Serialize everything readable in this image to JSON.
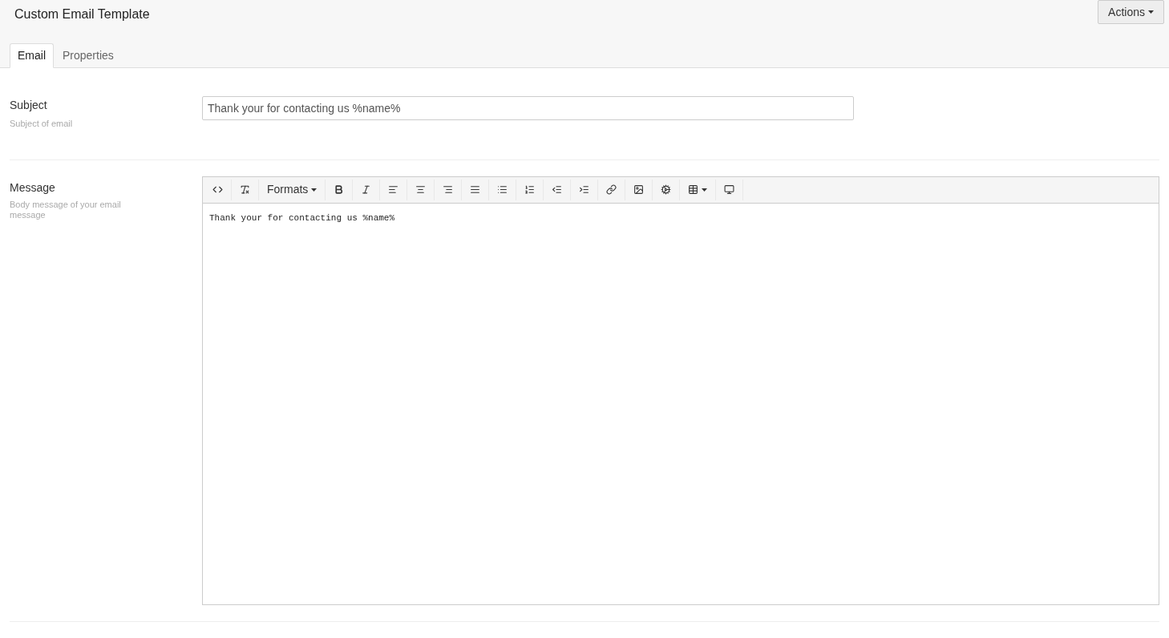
{
  "header": {
    "title": "Custom Email Template",
    "actions_button": "Actions"
  },
  "tabs": [
    {
      "label": "Email",
      "selected": true
    },
    {
      "label": "Properties",
      "selected": false
    }
  ],
  "subject": {
    "label": "Subject",
    "hint": "Subject of email",
    "value": "Thank your for contacting us %name%"
  },
  "message": {
    "label": "Message",
    "hint": "Body message of your email message",
    "formats_menu": "Formats",
    "body": "Thank your for contacting us %name%"
  }
}
